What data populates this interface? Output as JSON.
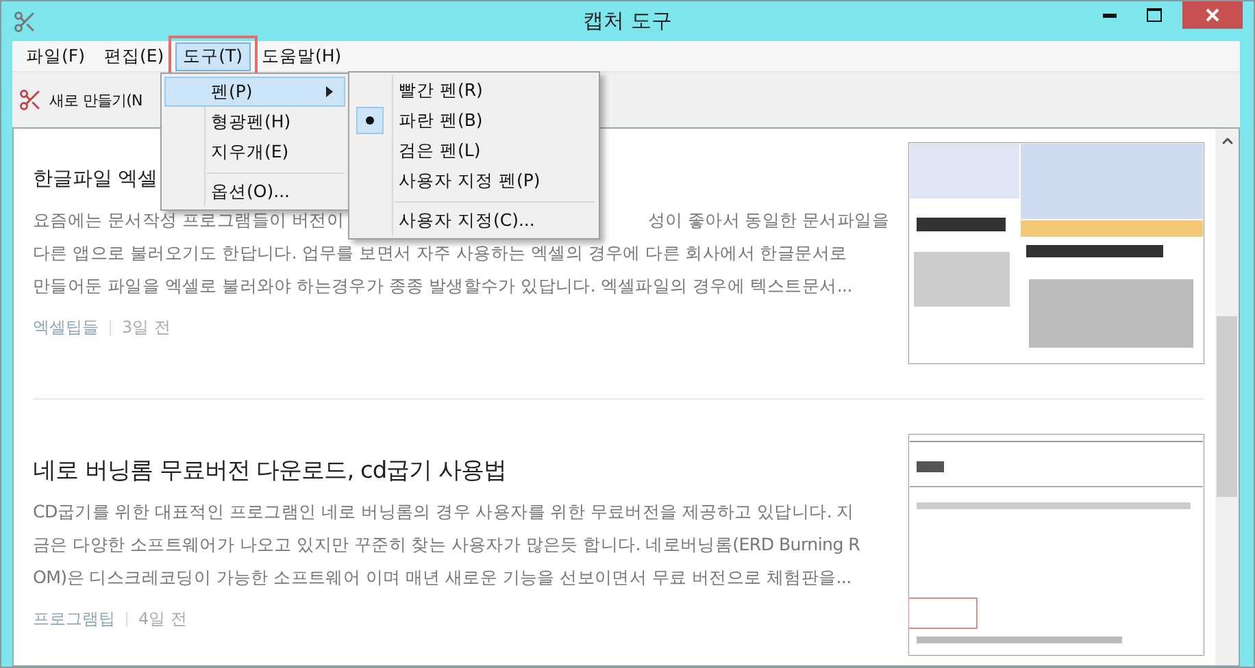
{
  "window": {
    "title": "캡처 도구"
  },
  "menu_bar": {
    "items": [
      {
        "label": "파일(F)",
        "selected": false,
        "outlined": false
      },
      {
        "label": "편집(E)",
        "selected": false,
        "outlined": false
      },
      {
        "label": "도구(T)",
        "selected": true,
        "outlined": true
      },
      {
        "label": "도움말(H)",
        "selected": false,
        "outlined": false
      }
    ]
  },
  "toolbar": {
    "new_button": "새로 만들기(N"
  },
  "tools_menu": {
    "items": [
      {
        "label": "펜(P)",
        "selected": true,
        "has_submenu": true,
        "separator_before": false
      },
      {
        "label": "형광펜(H)",
        "selected": false,
        "has_submenu": false,
        "separator_before": false
      },
      {
        "label": "지우개(E)",
        "selected": false,
        "has_submenu": false,
        "separator_before": false
      },
      {
        "label": "옵션(O)...",
        "selected": false,
        "has_submenu": false,
        "separator_before": true
      }
    ]
  },
  "pen_submenu": {
    "items": [
      {
        "label": "빨간 펜(R)",
        "checked": false,
        "separator_before": false
      },
      {
        "label": "파란 펜(B)",
        "checked": true,
        "separator_before": false
      },
      {
        "label": "검은 펜(L)",
        "checked": false,
        "separator_before": false
      },
      {
        "label": "사용자 지정 펜(P)",
        "checked": false,
        "separator_before": false
      },
      {
        "label": "사용자 지정(C)...",
        "checked": false,
        "separator_before": true
      }
    ]
  },
  "posts": [
    {
      "title": "한글파일 엑셀",
      "lines": [
        [
          "요즘에는 문서작성 프로그램들이 버전이",
          "성이 좋아서 동일한 문서파일을"
        ],
        [
          "다른 앱으로 불러오기도 한답니다. 업무를 보면서 자주 사용하는 엑셀의 경우에 다른 회사에서 한글문서로"
        ],
        [
          "만들어둔 파일을 엑셀로 불러와야 하는경우가 종종 발생할수가 있답니다. 엑셀파일의 경우에 텍스트문서..."
        ]
      ],
      "category": "엑셀팁들",
      "age": "3일 전",
      "thumbnail": {
        "kind": "picture"
      }
    },
    {
      "title": "네로 버닝롬 무료버전 다운로드, cd굽기 사용법",
      "lines": [
        [
          "CD굽기를 위한 대표적인 프로그램인 네로 버닝롬의 경우 사용자를 위한 무료버전을 제공하고 있답니다. 지"
        ],
        [
          "금은 다양한 소프트웨어가 나오고 있지만 꾸준히 찾는 사용자가 많은듯 합니다. 네로버닝롬(ERD Burning R"
        ],
        [
          "OM)은 디스크레코딩이 가능한 소프트웨어 이며 매년 새로운 기능을 선보이면서 무료 버전으로 체험판을..."
        ]
      ],
      "category": "프로그램팁",
      "age": "4일 전",
      "thumbnail": {
        "kind": "picture"
      }
    }
  ]
}
